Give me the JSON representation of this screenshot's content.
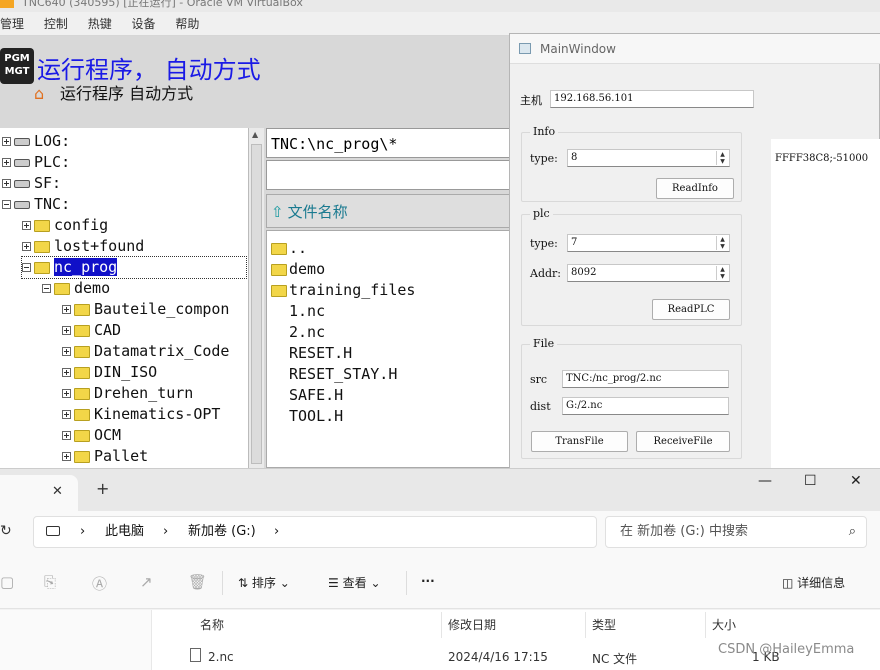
{
  "vbox": {
    "title": "TNC640 (340595) [正在运行] - Oracle VM VirtualBox",
    "menu": [
      "管理",
      "控制",
      "热键",
      "设备",
      "帮助"
    ]
  },
  "tnc": {
    "pgm_badge_line1": "PGM",
    "pgm_badge_line2": "MGT",
    "title": "运行程序， 自动方式",
    "subtitle": "运行程序  自动方式",
    "tree": [
      {
        "label": "LOG:",
        "type": "drive",
        "indent": 0
      },
      {
        "label": "PLC:",
        "type": "drive",
        "indent": 0
      },
      {
        "label": "SF:",
        "type": "drive",
        "indent": 0
      },
      {
        "label": "TNC:",
        "type": "drive",
        "indent": 0,
        "expanded": true
      },
      {
        "label": "config",
        "type": "folder",
        "indent": 1
      },
      {
        "label": "lost+found",
        "type": "folder",
        "indent": 1
      },
      {
        "label": "nc_prog",
        "type": "folder",
        "indent": 1,
        "expanded": true,
        "selected": true
      },
      {
        "label": "demo",
        "type": "folder",
        "indent": 2,
        "expanded": true
      },
      {
        "label": "Bauteile_compon",
        "type": "folder",
        "indent": 3
      },
      {
        "label": "CAD",
        "type": "folder",
        "indent": 3
      },
      {
        "label": "Datamatrix_Code",
        "type": "folder",
        "indent": 3
      },
      {
        "label": "DIN_ISO",
        "type": "folder",
        "indent": 3
      },
      {
        "label": "Drehen_turn",
        "type": "folder",
        "indent": 3
      },
      {
        "label": "Kinematics-OPT",
        "type": "folder",
        "indent": 3
      },
      {
        "label": "OCM",
        "type": "folder",
        "indent": 3
      },
      {
        "label": "Pallet",
        "type": "folder",
        "indent": 3
      }
    ],
    "path": "TNC:\\nc_prog\\*",
    "files_header": "文件名称",
    "files": [
      {
        "name": "..",
        "folder": true
      },
      {
        "name": "demo",
        "folder": true
      },
      {
        "name": "training_files",
        "folder": true
      },
      {
        "name": "1.nc",
        "folder": false
      },
      {
        "name": "2.nc",
        "folder": false
      },
      {
        "name": "RESET.H",
        "folder": false
      },
      {
        "name": "RESET_STAY.H",
        "folder": false
      },
      {
        "name": "SAFE.H",
        "folder": false
      },
      {
        "name": "TOOL.H",
        "folder": false
      }
    ]
  },
  "mainwindow": {
    "title": "MainWindow",
    "host_label": "主机",
    "host_value": "192.168.56.101",
    "info": {
      "group": "Info",
      "type_label": "type:",
      "type_value": "8",
      "button": "ReadInfo"
    },
    "plc": {
      "group": "plc",
      "type_label": "type:",
      "type_value": "7",
      "addr_label": "Addr:",
      "addr_value": "8092",
      "button": "ReadPLC"
    },
    "file": {
      "group": "File",
      "src_label": "src",
      "src_value": "TNC:/nc_prog/2.nc",
      "dist_label": "dist",
      "dist_value": "G:/2.nc",
      "trans_button": "TransFile",
      "receive_button": "ReceiveFile"
    },
    "output": "FFFF38C8;-51000"
  },
  "explorer": {
    "tab_close": "✕",
    "new_tab": "+",
    "window_controls": {
      "minimize": "—",
      "maximize": "☐",
      "close": "✕"
    },
    "breadcrumbs": [
      "此电脑",
      "新加卷 (G:)"
    ],
    "search_placeholder": "在 新加卷 (G:) 中搜索",
    "toolbar": {
      "sort": "排序",
      "view": "查看",
      "more": "···",
      "details": "详细信息"
    },
    "columns": {
      "name": "名称",
      "modified": "修改日期",
      "type": "类型",
      "size": "大小"
    },
    "rows": [
      {
        "name": "2.nc",
        "modified": "2024/4/16 17:15",
        "type": "NC 文件",
        "size": "1 KB"
      }
    ]
  },
  "watermark": "CSDN @HaileyEmma"
}
